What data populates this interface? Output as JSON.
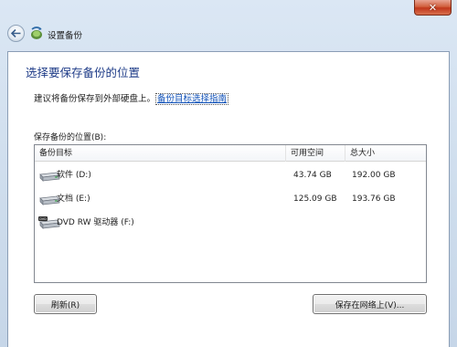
{
  "window": {
    "title": "设置备份",
    "close_glyph": "✕"
  },
  "main": {
    "heading": "选择要保存备份的位置",
    "suggestion_text": "建议将备份保存到外部硬盘上。",
    "suggestion_link": "备份目标选择指南",
    "location_label": "保存备份的位置(B):"
  },
  "list": {
    "columns": [
      "备份目标",
      "可用空间",
      "总大小"
    ],
    "rows": [
      {
        "name": "软件 (D:)",
        "free": "43.74 GB",
        "total": "192.00 GB",
        "icon": "hard-drive-icon"
      },
      {
        "name": "文档 (E:)",
        "free": "125.09 GB",
        "total": "193.76 GB",
        "icon": "hard-drive-icon"
      },
      {
        "name": "DVD RW 驱动器 (F:)",
        "free": "",
        "total": "",
        "icon": "dvd-drive-icon"
      }
    ]
  },
  "buttons": {
    "refresh": "刷新(R)",
    "save_network": "保存在网络上(V)..."
  },
  "colors": {
    "heading": "#1f3c88",
    "link": "#0f50b8",
    "frame": "#cddcec",
    "close": "#c1371b"
  }
}
